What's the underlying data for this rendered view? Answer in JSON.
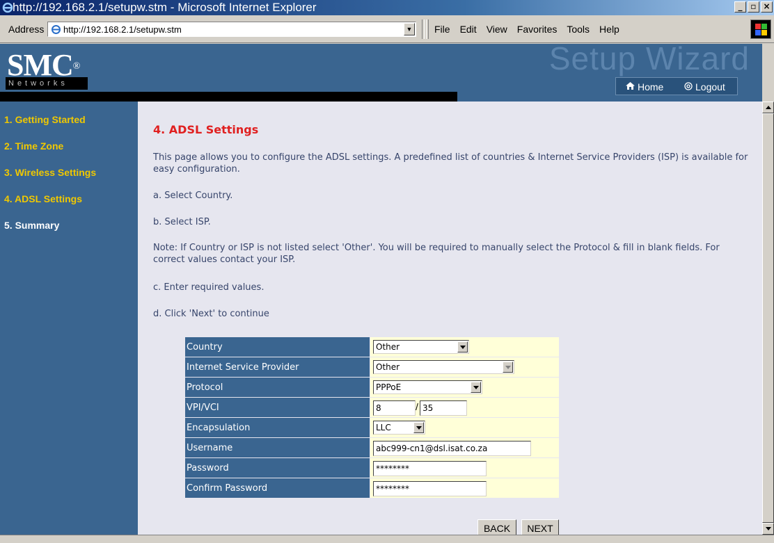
{
  "window": {
    "title": "http://192.168.2.1/setupw.stm - Microsoft Internet Explorer",
    "buttons": [
      "_",
      "Ē",
      "x"
    ]
  },
  "addressbar": {
    "label": "Address",
    "url": "http://192.168.2.1/setupw.stm"
  },
  "menu": [
    "File",
    "Edit",
    "View",
    "Favorites",
    "Tools",
    "Help"
  ],
  "banner": {
    "logo": "SMC",
    "registered": "®",
    "networks": "Networks",
    "wizard_title": "Setup Wizard",
    "home_label": "Home",
    "logout_label": "Logout"
  },
  "sidebar": {
    "items": [
      {
        "label": "1. Getting Started"
      },
      {
        "label": "2. Time Zone"
      },
      {
        "label": "3. Wireless Settings"
      },
      {
        "label": "4. ADSL Settings"
      },
      {
        "label": "5. Summary"
      }
    ]
  },
  "content": {
    "heading": "4. ADSL Settings",
    "intro": "This page allows you to configure the ADSL settings. A predefined list of countries & Internet Service Providers (ISP) is available for easy configuration.",
    "step_a": "a. Select Country.",
    "step_b": "b. Select ISP.",
    "note": "Note: If Country or ISP is not listed select 'Other'. You will be required to manually select the Protocol & fill in blank fields. For correct values contact your ISP.",
    "step_c": "c. Enter required values.",
    "step_d": "d. Click 'Next' to continue"
  },
  "form": {
    "country": {
      "label": "Country",
      "value": "Other"
    },
    "isp": {
      "label": "Internet Service Provider",
      "value": "Other"
    },
    "protocol": {
      "label": "Protocol",
      "value": "PPPoE"
    },
    "vpivci": {
      "label": "VPI/VCI",
      "vpi": "8",
      "vci": "35"
    },
    "encapsulation": {
      "label": "Encapsulation",
      "value": "LLC"
    },
    "username": {
      "label": "Username",
      "value": "abc999-cn1@dsl.isat.co.za"
    },
    "password": {
      "label": "Password",
      "value": "********"
    },
    "confirm_password": {
      "label": "Confirm Password",
      "value": "********"
    }
  },
  "buttons": {
    "back": "BACK",
    "next": "NEXT"
  }
}
